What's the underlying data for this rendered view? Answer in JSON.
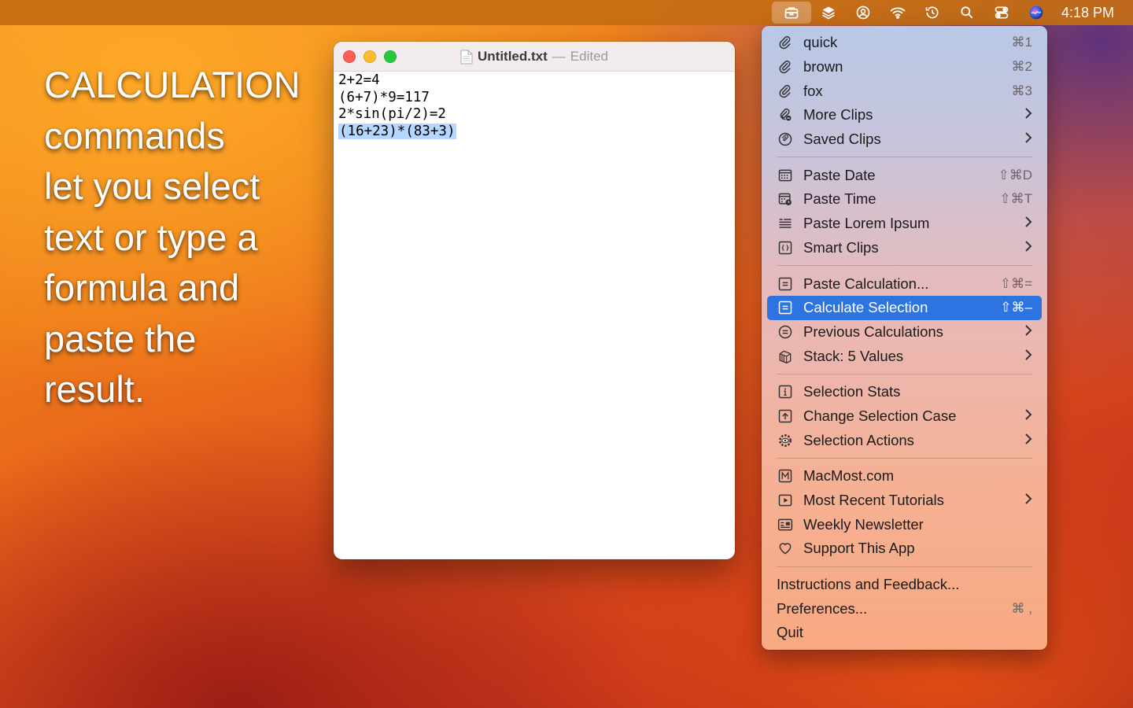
{
  "menubar": {
    "icons": [
      "toolbox-icon",
      "layers-icon",
      "user-circle-icon",
      "wifi-icon",
      "time-machine-icon",
      "search-icon",
      "control-center-icon",
      "siri-icon"
    ],
    "clock": "4:18 PM"
  },
  "caption": {
    "lines": [
      "CALCULATION",
      "commands",
      "let you select",
      "text or type a",
      "formula and",
      "paste the",
      "result."
    ]
  },
  "window": {
    "filename": "Untitled.txt",
    "separator": "—",
    "status": "Edited",
    "lines": [
      "2+2=4",
      "(6+7)*9=117",
      "2*sin(pi/2)=2",
      "(16+23)*(83+3)"
    ]
  },
  "menu": {
    "items": [
      {
        "label": "quick",
        "shortcut": "⌘1",
        "icon": "paperclip-icon"
      },
      {
        "label": "brown",
        "shortcut": "⌘2",
        "icon": "paperclip-icon"
      },
      {
        "label": "fox",
        "shortcut": "⌘3",
        "icon": "paperclip-icon"
      },
      {
        "label": "More Clips",
        "icon": "paperclip-more-icon",
        "submenu": true
      },
      {
        "label": "Saved Clips",
        "icon": "saved-clips-icon",
        "submenu": true
      },
      {
        "label": "Paste Date",
        "shortcut": "⇧⌘D",
        "icon": "calendar-icon"
      },
      {
        "label": "Paste Time",
        "shortcut": "⇧⌘T",
        "icon": "calendar-clock-icon"
      },
      {
        "label": "Paste Lorem Ipsum",
        "icon": "text-lines-icon",
        "submenu": true
      },
      {
        "label": "Smart Clips",
        "icon": "braces-icon",
        "submenu": true
      },
      {
        "label": "Paste Calculation...",
        "shortcut": "⇧⌘=",
        "icon": "equals-square-icon"
      },
      {
        "label": "Calculate Selection",
        "shortcut": "⇧⌘–",
        "icon": "equals-square-icon",
        "selected": true
      },
      {
        "label": "Previous Calculations",
        "icon": "equals-circle-icon",
        "submenu": true
      },
      {
        "label": "Stack: 5 Values",
        "icon": "stack-icon",
        "submenu": true
      },
      {
        "label": "Selection Stats",
        "icon": "info-square-icon"
      },
      {
        "label": "Change Selection Case",
        "icon": "arrow-up-square-icon",
        "submenu": true
      },
      {
        "label": "Selection Actions",
        "icon": "gear-eye-icon",
        "submenu": true
      },
      {
        "label": "MacMost.com",
        "icon": "m-square-icon"
      },
      {
        "label": "Most Recent Tutorials",
        "icon": "play-square-icon",
        "submenu": true
      },
      {
        "label": "Weekly Newsletter",
        "icon": "newsletter-icon"
      },
      {
        "label": "Support This App",
        "icon": "heart-icon"
      },
      {
        "label": "Instructions and Feedback..."
      },
      {
        "label": "Preferences...",
        "shortcut": "⌘ ,"
      },
      {
        "label": "Quit"
      }
    ],
    "groups": [
      [
        0,
        1,
        2,
        3,
        4
      ],
      [
        5,
        6,
        7,
        8
      ],
      [
        9,
        10,
        11,
        12
      ],
      [
        13,
        14,
        15
      ],
      [
        16,
        17,
        18,
        19
      ],
      [
        20,
        21,
        22
      ]
    ]
  }
}
